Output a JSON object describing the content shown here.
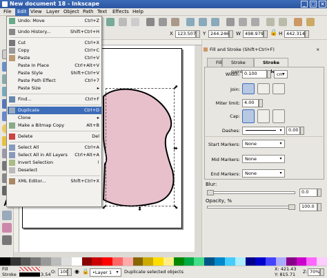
{
  "window": {
    "title": "New document 18 - Inkscape"
  },
  "menubar": {
    "items": [
      "File",
      "Edit",
      "View",
      "Layer",
      "Object",
      "Path",
      "Text",
      "Effects",
      "Help"
    ]
  },
  "controls": {
    "x_label": "X",
    "x_value": "123.507",
    "y_label": "Y",
    "y_value": "244.246",
    "w_label": "W",
    "w_value": "498.979",
    "h_label": "H",
    "h_value": "442.314"
  },
  "edit_menu": {
    "items": [
      {
        "label": "Undo: Move",
        "accel": "Ctrl+Z",
        "icon": "undo-icon"
      },
      {
        "sep": true
      },
      {
        "label": "Undo History...",
        "accel": "Shift+Ctrl+H",
        "icon": "history-icon"
      },
      {
        "sep": true
      },
      {
        "label": "Cut",
        "accel": "Ctrl+X",
        "icon": "cut-icon"
      },
      {
        "label": "Copy",
        "accel": "Ctrl+C",
        "icon": "copy-icon"
      },
      {
        "label": "Paste",
        "accel": "Ctrl+V",
        "icon": "paste-icon"
      },
      {
        "label": "Paste In Place",
        "accel": "Ctrl+Alt+V",
        "icon": ""
      },
      {
        "label": "Paste Style",
        "accel": "Shift+Ctrl+V",
        "icon": ""
      },
      {
        "label": "Paste Path Effect",
        "accel": "Ctrl+7",
        "icon": ""
      },
      {
        "label": "Paste Size",
        "accel": "▸",
        "icon": ""
      },
      {
        "sep": true
      },
      {
        "label": "Find...",
        "accel": "Ctrl+F",
        "icon": "find-icon"
      },
      {
        "sep": true
      },
      {
        "label": "Duplicate",
        "accel": "Ctrl+D",
        "icon": "duplicate-icon",
        "highlight": true
      },
      {
        "label": "Clone",
        "accel": "▸",
        "icon": ""
      },
      {
        "label": "Make a Bitmap Copy",
        "accel": "Alt+B",
        "icon": "bitmap-icon"
      },
      {
        "sep": true
      },
      {
        "label": "Delete",
        "accel": "Del",
        "icon": "delete-icon"
      },
      {
        "sep": true
      },
      {
        "label": "Select All",
        "accel": "Ctrl+A",
        "icon": "select-all-icon"
      },
      {
        "label": "Select All in All Layers",
        "accel": "Ctrl+Alt+A",
        "icon": "select-all-layers-icon"
      },
      {
        "label": "Invert Selection",
        "accel": "!",
        "icon": "invert-icon"
      },
      {
        "label": "Deselect",
        "accel": "",
        "icon": "deselect-icon"
      },
      {
        "sep": true
      },
      {
        "label": "XML Editor...",
        "accel": "Shift+Ctrl+X",
        "icon": "xml-icon"
      }
    ]
  },
  "dock": {
    "title": "Fill and Stroke (Shift+Ctrl+F)",
    "tabs": [
      "Fill",
      "Stroke paint",
      "Stroke style"
    ],
    "width_label": "Width:",
    "width_value": "0.100",
    "width_unit": "cm",
    "join_label": "Join:",
    "miter_label": "Miter limit:",
    "miter_value": "4.00",
    "cap_label": "Cap:",
    "dashes_label": "Dashes:",
    "dashes_value": "0.00",
    "start_markers_label": "Start Markers:",
    "start_markers_value": "None",
    "mid_markers_label": "Mid Markers:",
    "mid_markers_value": "None",
    "end_markers_label": "End Markers:",
    "end_markers_value": "None",
    "blur_label": "Blur:",
    "blur_value": "0.0",
    "opacity_label": "Opacity, %",
    "opacity_value": "100.0"
  },
  "statusbar": {
    "fill_label": "Fill",
    "stroke_label": "Stroke",
    "stroke_width": "3.54",
    "o_label": "O:",
    "o_value": "100",
    "layer": "•Layer 1",
    "message": "Duplicate selected objects",
    "x_coord": "X: 421.43",
    "y_coord": "Y: 815.71",
    "zoom_label": "Z:",
    "zoom_value": "70%"
  },
  "palette": {
    "colors": [
      "#000000",
      "#333333",
      "#555555",
      "#777777",
      "#999999",
      "#bbbbbb",
      "#dddddd",
      "#ffffff",
      "#880000",
      "#cc0000",
      "#ff0000",
      "#ff6666",
      "#ffaaaa",
      "#886600",
      "#ccaa00",
      "#ffdd00",
      "#ffee88",
      "#008800",
      "#00aa44",
      "#44dd88",
      "#005588",
      "#0088cc",
      "#44ccff",
      "#aaeeff",
      "#000088",
      "#0000cc",
      "#4444ff",
      "#aaaaff",
      "#880088",
      "#cc00cc",
      "#ff66ff",
      "#ffccff"
    ]
  },
  "colors": {
    "shape_fill": "#e8c0cc",
    "accent": "#3d6cb8"
  }
}
